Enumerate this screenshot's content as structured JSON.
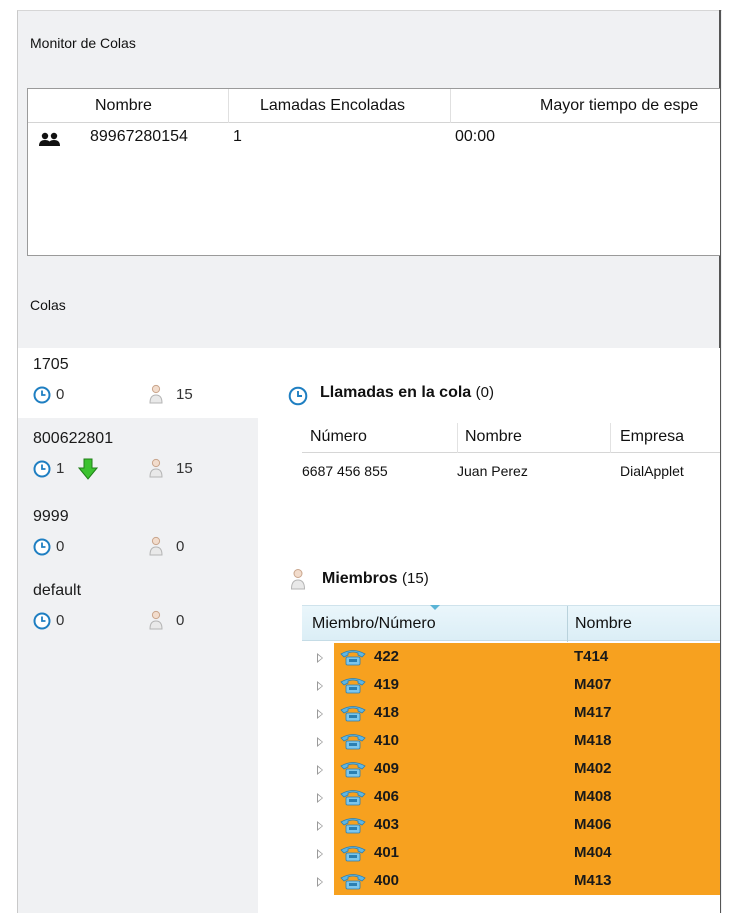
{
  "monitor": {
    "title": "Monitor de Colas",
    "columns": [
      "Nombre",
      "Lamadas Encoladas",
      "Mayor tiempo de espe"
    ],
    "rows": [
      {
        "icon": "group-icon",
        "name": "89967280154",
        "queued": "1",
        "max_wait": "00:00"
      }
    ]
  },
  "colas": {
    "title": "Colas",
    "queues": [
      {
        "name": "1705",
        "waiting": "0",
        "members": "15",
        "active": true,
        "trend": ""
      },
      {
        "name": "800622801",
        "waiting": "1",
        "members": "15",
        "active": false,
        "trend": "down-arrow-icon"
      },
      {
        "name": "9999",
        "waiting": "0",
        "members": "0",
        "active": false,
        "trend": ""
      },
      {
        "name": "default",
        "waiting": "0",
        "members": "0",
        "active": false,
        "trend": ""
      }
    ]
  },
  "calls": {
    "title": "Llamadas en la cola",
    "count": "(0)",
    "columns": [
      "Número",
      "Nombre",
      "Empresa"
    ],
    "rows": [
      {
        "numero": "6687 456 855",
        "nombre": "Juan Perez",
        "empresa": "DialApplet"
      }
    ]
  },
  "members": {
    "title": "Miembros",
    "count": "(15)",
    "columns": [
      "Miembro/Número",
      "Nombre"
    ],
    "highlight_color": "#f7a11f",
    "rows": [
      {
        "numero": "422",
        "nombre": "T414"
      },
      {
        "numero": "419",
        "nombre": "M407"
      },
      {
        "numero": "418",
        "nombre": "M417"
      },
      {
        "numero": "410",
        "nombre": "M418"
      },
      {
        "numero": "409",
        "nombre": "M402"
      },
      {
        "numero": "406",
        "nombre": "M408"
      },
      {
        "numero": "403",
        "nombre": "M406"
      },
      {
        "numero": "401",
        "nombre": "M404"
      },
      {
        "numero": "400",
        "nombre": "M413"
      }
    ]
  }
}
